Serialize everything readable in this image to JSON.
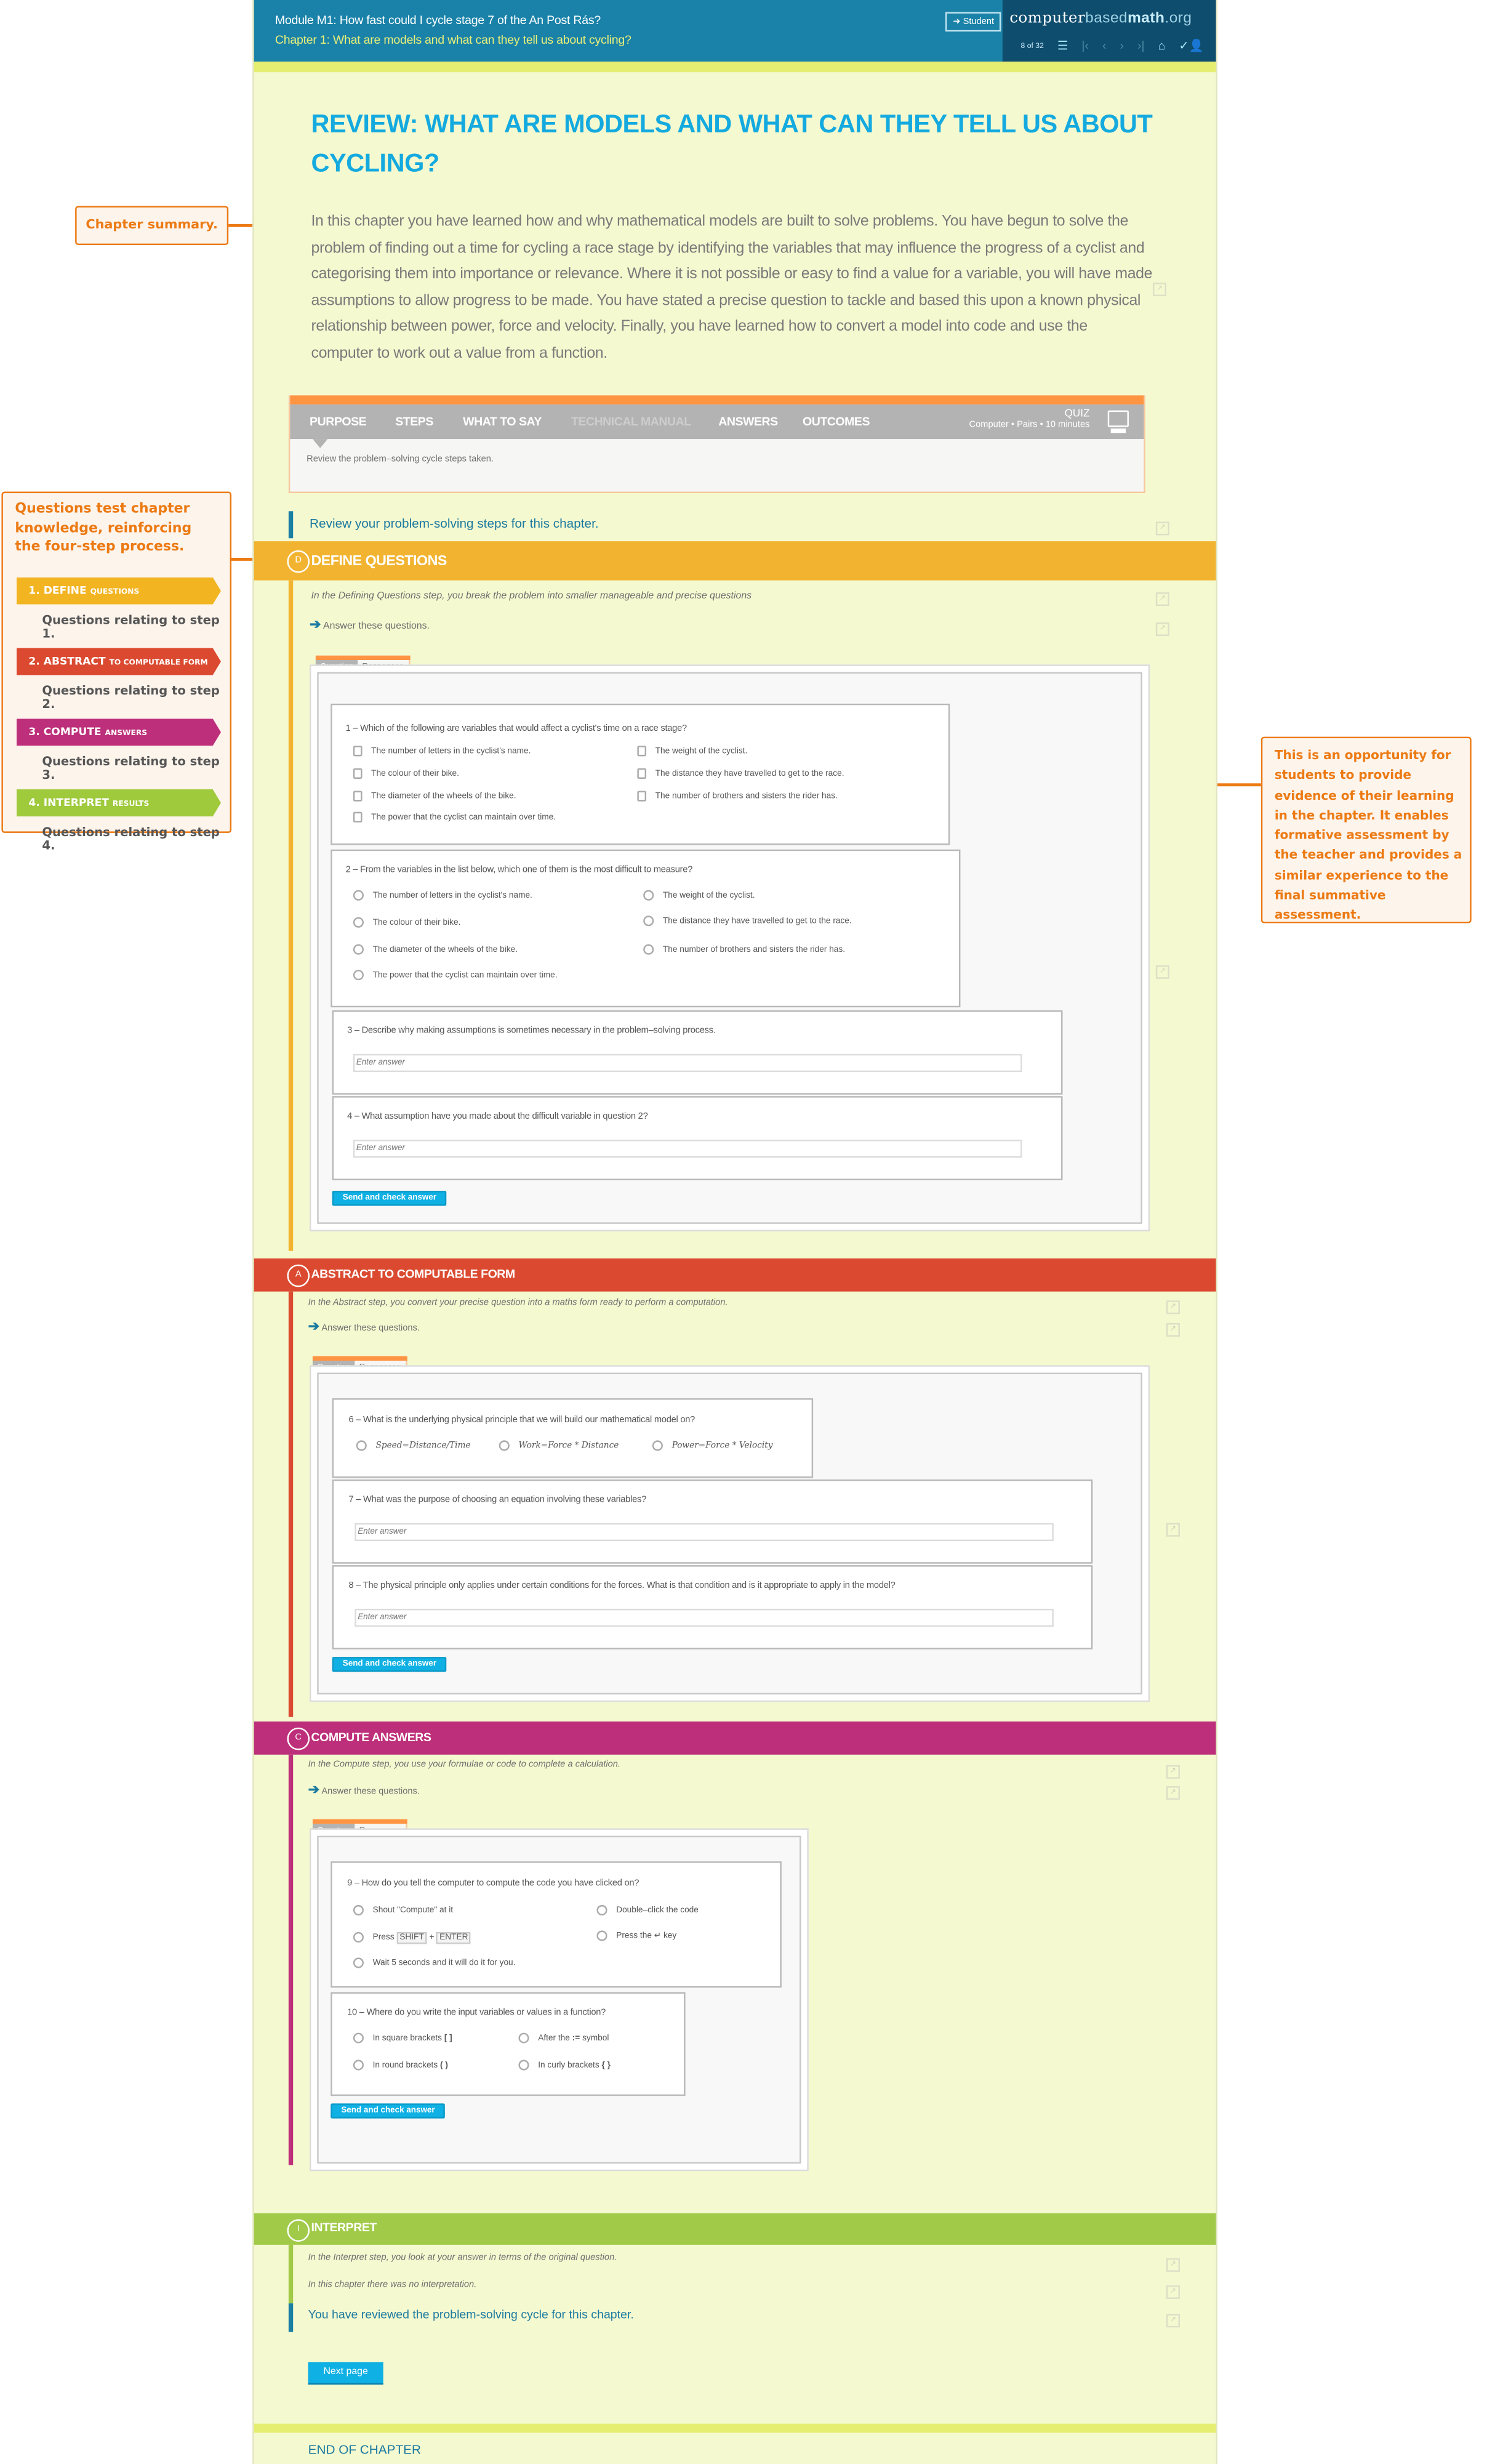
{
  "header": {
    "module_title": "Module M1: How fast could I cycle stage 7 of the An Post Rás?",
    "chapter_title": "Chapter 1: What are models and what can they tell us about cycling?",
    "student_button": "Student",
    "brand": {
      "part1": "computer",
      "part2": "based",
      "part3": "math",
      "part4": ".org"
    },
    "page_counter": "8 of 32",
    "nav_icons": [
      "list-icon",
      "first-page-icon",
      "prev-page-icon",
      "next-page-icon",
      "last-page-icon",
      "home-icon",
      "user-icon"
    ]
  },
  "page": {
    "title": "REVIEW: WHAT ARE MODELS AND WHAT CAN THEY TELL US ABOUT CYCLING?",
    "summary": "In this chapter you have learned how and why mathematical models are built to solve problems. You have begun to solve the problem of finding out a time for cycling a race stage by identifying the variables that may influence the progress of a cyclist and categorising them into importance or relevance. Where it is not possible or easy to find a value for a variable, you will have made assumptions to allow progress to be made. You have stated a precise question to tackle and based this upon a known physical relationship between power, force and velocity. Finally, you have learned how to convert a model into code and use the computer to work out a value from a function."
  },
  "teacher_tabs": {
    "tabs": [
      {
        "label": "PURPOSE",
        "enabled": true
      },
      {
        "label": "STEPS",
        "enabled": true
      },
      {
        "label": "WHAT TO SAY",
        "enabled": true
      },
      {
        "label": "TECHNICAL MANUAL",
        "enabled": false
      },
      {
        "label": "ANSWERS",
        "enabled": true
      },
      {
        "label": "OUTCOMES",
        "enabled": true
      }
    ],
    "activity_type": "QUIZ",
    "activity_meta": "Computer • Pairs • 10 minutes",
    "purpose_text": "Review the problem–solving cycle steps taken."
  },
  "review_intro": "Review your problem-solving steps for this chapter.",
  "colors": {
    "define": "#f2b430",
    "abstract": "#db4a30",
    "compute": "#bd2f7a",
    "interpret": "#a0ca48",
    "accent": "#1b7aa0",
    "callout": "#ec7a13"
  },
  "steps": {
    "define": {
      "letter": "D",
      "title": "DEFINE QUESTIONS",
      "intro": "In the Defining Questions step, you break the problem into smaller manageable and precise questions",
      "instruction": "Answer these questions."
    },
    "abstract": {
      "letter": "A",
      "title": "ABSTRACT TO COMPUTABLE FORM",
      "intro": "In the Abstract step, you convert your precise question into a maths form ready to perform a computation.",
      "instruction": "Answer these questions."
    },
    "compute": {
      "letter": "C",
      "title": "COMPUTE ANSWERS",
      "intro": "In the Compute step, you use your formulae or code to complete a calculation.",
      "instruction": "Answer these questions."
    },
    "interpret": {
      "letter": "I",
      "title": "INTERPRET",
      "intro": "In the Interpret step, you look at your answer in terms of the original question.",
      "note": "In this chapter there was no interpretation.",
      "closing": "You have reviewed the problem-solving cycle for this chapter."
    }
  },
  "quiz_tabs": {
    "question": "Question",
    "responses": "Responses"
  },
  "send_button": "Send and check answer",
  "answer_placeholder": "Enter answer",
  "questions": {
    "q1": {
      "text": "1 – Which of the following are variables that would affect a cyclist's time on a race stage?",
      "options": [
        "The number of letters in the cyclist's name.",
        "The weight of the cyclist.",
        "The colour of their bike.",
        "The distance they have travelled to get to the race.",
        "The diameter of the wheels of the bike.",
        "The number of brothers and sisters the rider has.",
        "The power that the cyclist can maintain over time."
      ]
    },
    "q2": {
      "text": "2 – From the variables in the list below, which one of them is the most difficult to measure?",
      "options": [
        "The number of letters in the cyclist's name.",
        "The weight of the cyclist.",
        "The colour of their bike.",
        "The distance they have travelled to get to the race.",
        "The diameter of the wheels of the bike.",
        "The number of brothers and sisters the rider has.",
        "The power that the cyclist can maintain over time."
      ]
    },
    "q3": {
      "text": "3 – Describe why making assumptions is sometimes necessary in the problem–solving process."
    },
    "q4": {
      "text": "4 – What assumption have you made about the difficult variable in question 2?"
    },
    "q6": {
      "text": "6 – What is the underlying physical principle that we will build our mathematical model on?",
      "options": [
        "Speed=Distance/Time",
        "Work=Force * Distance",
        "Power=Force * Velocity"
      ]
    },
    "q7": {
      "text": "7 – What was the purpose of choosing an equation involving these variables?"
    },
    "q8": {
      "text": "8 – The physical principle only applies under certain conditions for the forces. What is that condition and is it appropriate to apply in the model?"
    },
    "q9": {
      "text": "9 – How do you tell the computer to compute the code you have clicked on?",
      "options": {
        "a": "Shout \"Compute\" at it",
        "b": "Double–click the code",
        "c_prefix": "Press",
        "c_key1": "SHIFT",
        "c_plus": "+",
        "c_key2": "ENTER",
        "d": "Press the ↵ key",
        "e": "Wait 5 seconds and it will do it for you."
      }
    },
    "q10": {
      "text": "10 – Where do you write the input variables or values in a function?",
      "options": {
        "a": "In square brackets",
        "a_sym": "[ ]",
        "b": "After the",
        "b_sym": ":=",
        "b_suffix": "symbol",
        "c": "In round brackets",
        "c_sym": "( )",
        "d": "In curly brackets",
        "d_sym": "{ }"
      }
    }
  },
  "footer": {
    "next_button": "Next page",
    "end_label": "END OF CHAPTER"
  },
  "annotations": {
    "chapter_summary": "Chapter summary.",
    "questions_test": "Questions test chapter knowledge, reinforcing the four-step process.",
    "steps": [
      {
        "num": "1. DEFINE",
        "sub": "QUESTIONS",
        "desc": "Questions relating to step 1."
      },
      {
        "num": "2. ABSTRACT",
        "sub": "TO COMPUTABLE FORM",
        "desc": "Questions relating to step 2."
      },
      {
        "num": "3. COMPUTE",
        "sub": "ANSWERS",
        "desc": "Questions relating to step 3."
      },
      {
        "num": "4. INTERPRET",
        "sub": "RESULTS",
        "desc": "Questions relating to step 4."
      }
    ],
    "opportunity": "This is an opportunity for students to provide evidence of their learning in the chapter. It enables formative assessment by the teacher and provides a similar experience to the final summative assessment."
  }
}
